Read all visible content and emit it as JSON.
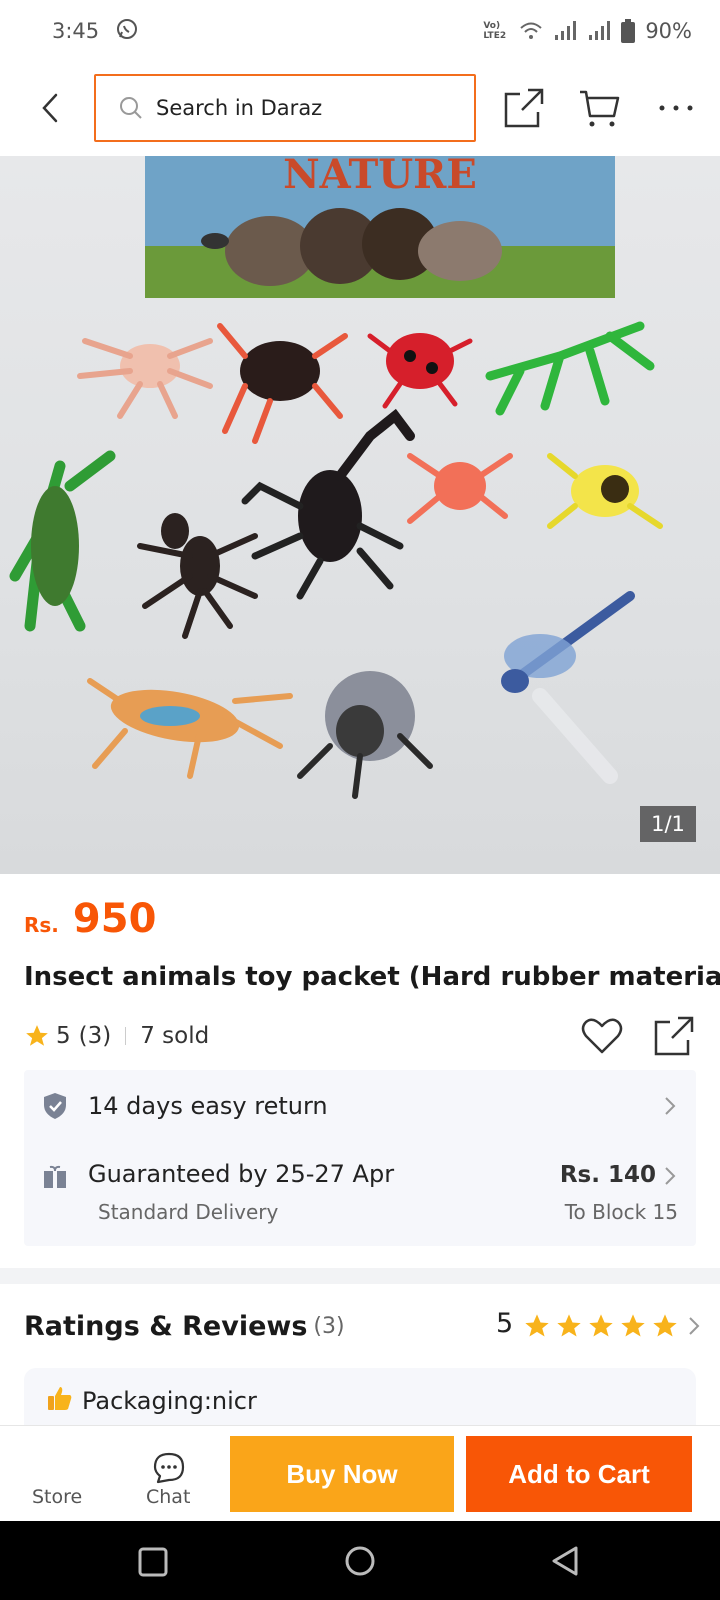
{
  "status_bar": {
    "time": "3:45",
    "battery": "90%",
    "network_label": "Vo) LTE2"
  },
  "top_bar": {
    "search_placeholder": "Search in Daraz"
  },
  "gallery": {
    "counter": "1/1",
    "box_text": "NATURE"
  },
  "product": {
    "currency": "Rs.",
    "price": "950",
    "title": "Insect animals toy packet (Hard rubber material)",
    "rating": "5",
    "rating_count": "(3)",
    "sold": "7 sold"
  },
  "info": {
    "return": "14 days easy return",
    "delivery": "Guaranteed by 25-27 Apr",
    "delivery_type": "Standard Delivery",
    "delivery_fee": "Rs. 140",
    "delivery_location": "To Block 15"
  },
  "ratings": {
    "title": "Ratings & Reviews",
    "count": "(3)",
    "score": "5",
    "stars": 5,
    "first_review": "Packaging:nicr"
  },
  "actions": {
    "store": "Store",
    "chat": "Chat",
    "buy_now": "Buy Now",
    "add_to_cart": "Add to Cart"
  },
  "colors": {
    "brand_orange": "#f85606",
    "buy_now": "#faa519",
    "star": "#f8b31b"
  }
}
